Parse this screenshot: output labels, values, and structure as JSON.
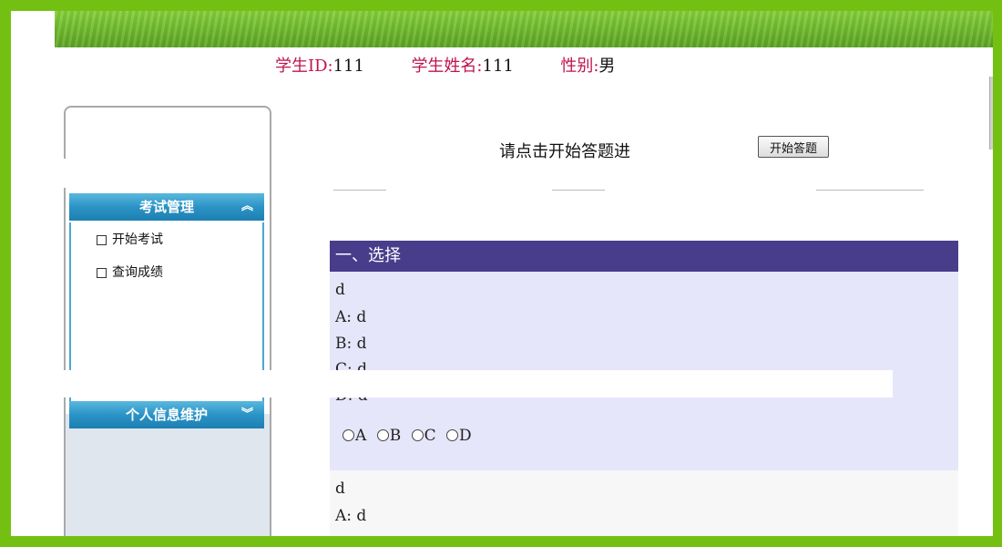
{
  "student_info": {
    "id_label": "学生ID:",
    "id_value": "111",
    "name_label": "学生姓名:",
    "name_value": "111",
    "gender_label": "性别:",
    "gender_value": "男"
  },
  "sidebar": {
    "exam_header": "考试管理",
    "exam_chev": "︽",
    "items": [
      {
        "label": "开始考试"
      },
      {
        "label": "查询成绩"
      }
    ],
    "profile_header": "个人信息维护",
    "profile_chev": "︾"
  },
  "main": {
    "prompt": "请点击开始答题进",
    "start_button": "开始答题",
    "section_title": "一、选择",
    "questions": [
      {
        "stem": "d",
        "options": [
          "A: d",
          "B: d",
          "C: d",
          "D: d"
        ],
        "choices": [
          "A",
          "B",
          "C",
          "D"
        ]
      },
      {
        "stem": "d",
        "options": [
          "A: d"
        ]
      }
    ]
  },
  "colors": {
    "frame": "#74c012",
    "section_header": "#483d8b",
    "question_bg": "#e6e6fa",
    "label_red": "#c0144c",
    "side_header": "#2b93c6"
  }
}
